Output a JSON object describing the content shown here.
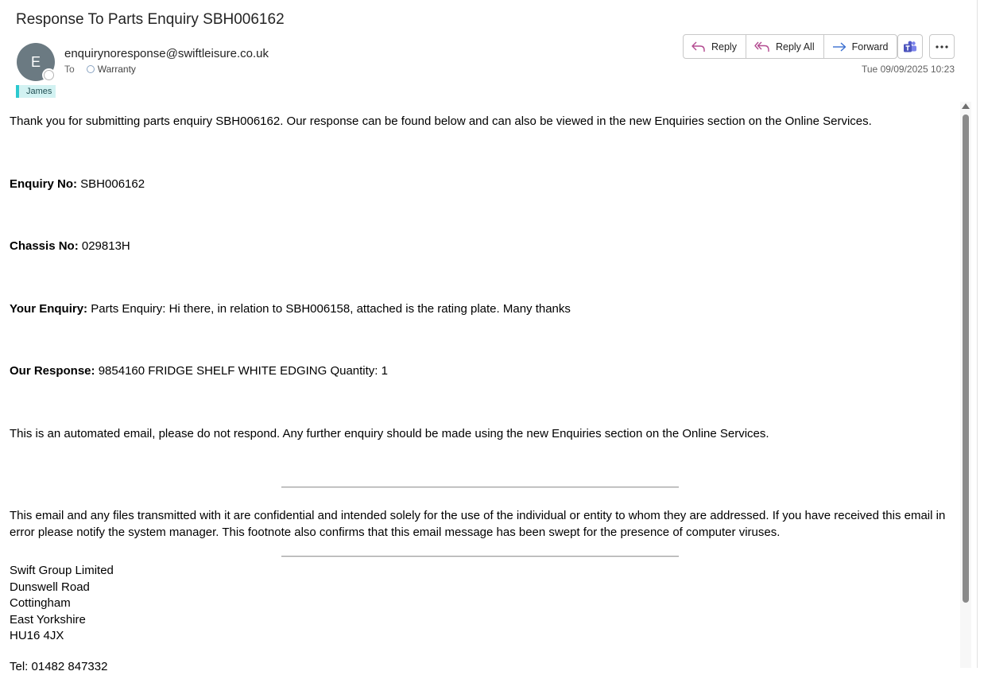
{
  "email": {
    "subject": "Response To Parts Enquiry SBH006162",
    "avatar_initial": "E",
    "sender": "enquirynoresponse@swiftleisure.co.uk",
    "to_label": "To",
    "recipient": "Warranty",
    "category_tag": "James",
    "datetime": "Tue 09/09/2025 10:23"
  },
  "actions": {
    "reply": "Reply",
    "reply_all": "Reply All",
    "forward": "Forward",
    "teams_icon": "teams-icon",
    "more_icon": "more-options-icon"
  },
  "colors": {
    "tag_accent": "#2cc9cf",
    "tag_bg": "#d2f2f2",
    "avatar_bg": "#6b7a82",
    "reply_icon": "#b34a90",
    "forward_icon": "#3a6fd0",
    "teams_icon": "#5059c9"
  },
  "body": {
    "thanks": "Thank you for submitting parts enquiry SBH006162. Our response can be found below and can also be viewed in the new Enquiries section on the Online Services.",
    "enquiry_no_label": "Enquiry No:",
    "enquiry_no": " SBH006162",
    "chassis_label": "Chassis No:",
    "chassis_no": " 029813H",
    "your_enquiry_label": "Your Enquiry:",
    "your_enquiry": " Parts Enquiry: Hi there, in relation to SBH006158, attached is the rating plate. Many thanks",
    "our_response_label": "Our Response:",
    "our_response": " 9854160 FRIDGE SHELF WHITE EDGING Quantity: 1",
    "automated": "This is an automated email, please do not respond. Any further enquiry should be made using the new Enquiries section on the Online Services.",
    "confidential": "This email and any files transmitted with it are confidential and intended solely for the use of the individual or entity to whom they are addressed. If you have received this email in error please notify the system manager. This footnote also confirms that this email message has been swept for the presence of computer viruses.",
    "address": [
      "Swift Group Limited",
      "Dunswell Road",
      "Cottingham",
      "East Yorkshire",
      "HU16 4JX"
    ],
    "tel": "Tel: 01482 847332"
  }
}
